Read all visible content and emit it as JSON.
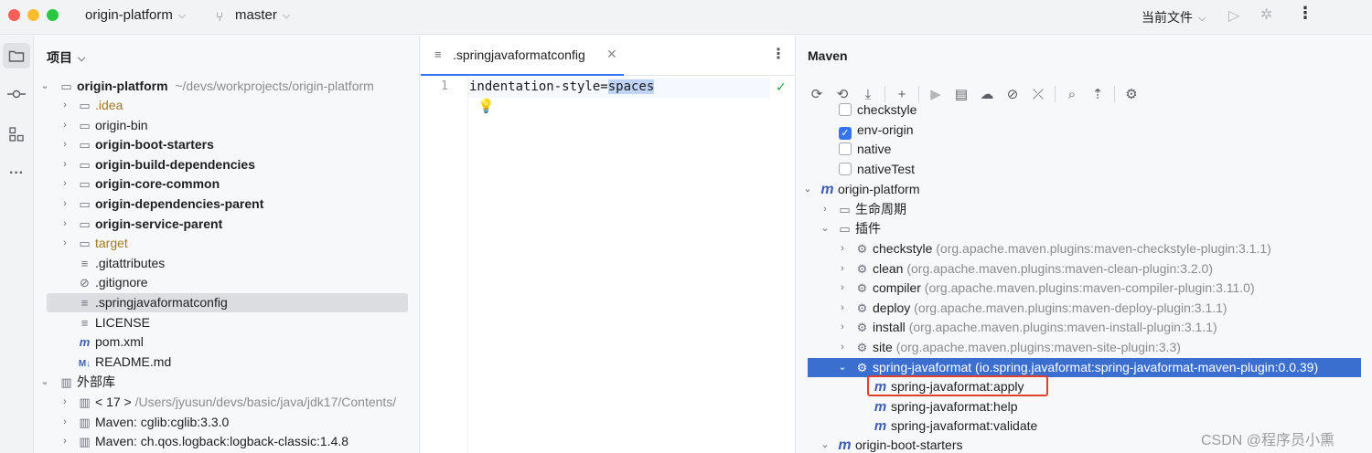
{
  "titlebar": {
    "project_name": "origin-platform",
    "branch": "master",
    "current_file": "当前文件",
    "icons": [
      "chevron-down-icon",
      "branch-icon",
      "run-icon",
      "debug-icon",
      "more-icon"
    ]
  },
  "project_panel": {
    "title": "项目",
    "root": {
      "name": "origin-platform",
      "path": "~/devs/workprojects/origin-platform"
    },
    "items": [
      {
        "label": ".idea",
        "icon": "folder-icon",
        "style": "orange"
      },
      {
        "label": "origin-bin",
        "icon": "folder-icon",
        "style": "normal"
      },
      {
        "label": "origin-boot-starters",
        "icon": "module-folder-icon",
        "style": "bold"
      },
      {
        "label": "origin-build-dependencies",
        "icon": "module-folder-icon",
        "style": "bold"
      },
      {
        "label": "origin-core-common",
        "icon": "module-folder-icon",
        "style": "bold"
      },
      {
        "label": "origin-dependencies-parent",
        "icon": "module-folder-icon",
        "style": "bold"
      },
      {
        "label": "origin-service-parent",
        "icon": "module-folder-icon",
        "style": "bold"
      },
      {
        "label": "target",
        "icon": "folder-icon",
        "style": "orange"
      },
      {
        "label": ".gitattributes",
        "icon": "text-file-icon",
        "style": "normal"
      },
      {
        "label": ".gitignore",
        "icon": "ignore-file-icon",
        "style": "normal"
      },
      {
        "label": ".springjavaformatconfig",
        "icon": "text-file-icon",
        "style": "normal"
      },
      {
        "label": "LICENSE",
        "icon": "text-file-icon",
        "style": "normal"
      },
      {
        "label": "pom.xml",
        "icon": "maven-icon",
        "style": "normal"
      },
      {
        "label": "README.md",
        "icon": "markdown-icon",
        "style": "normal"
      }
    ],
    "external_libs": "外部库",
    "libs": [
      {
        "label": "< 17 >",
        "path": "/Users/jyusun/devs/basic/java/jdk17/Contents/"
      },
      {
        "label": "Maven: cglib:cglib:3.3.0",
        "path": ""
      },
      {
        "label": "Maven: ch.qos.logback:logback-classic:1.4.8",
        "path": ""
      }
    ]
  },
  "editor": {
    "tab_label": ".springjavaformatconfig",
    "line_number": "1",
    "code_key": "indentation-style=",
    "code_value": "spaces"
  },
  "maven_panel": {
    "title": "Maven",
    "profiles": [
      {
        "label": "checkstyle",
        "checked": false
      },
      {
        "label": "env-origin",
        "checked": true
      },
      {
        "label": "native",
        "checked": false
      },
      {
        "label": "nativeTest",
        "checked": false
      }
    ],
    "project": "origin-platform",
    "lifecycle": "生命周期",
    "plugins_label": "插件",
    "plugins": [
      {
        "name": "checkstyle",
        "artifact": "(org.apache.maven.plugins:maven-checkstyle-plugin:3.1.1)"
      },
      {
        "name": "clean",
        "artifact": "(org.apache.maven.plugins:maven-clean-plugin:3.2.0)"
      },
      {
        "name": "compiler",
        "artifact": "(org.apache.maven.plugins:maven-compiler-plugin:3.11.0)"
      },
      {
        "name": "deploy",
        "artifact": "(org.apache.maven.plugins:maven-deploy-plugin:3.1.1)"
      },
      {
        "name": "install",
        "artifact": "(org.apache.maven.plugins:maven-install-plugin:3.1.1)"
      },
      {
        "name": "site",
        "artifact": "(org.apache.maven.plugins:maven-site-plugin:3.3)"
      },
      {
        "name": "spring-javaformat",
        "artifact": "(io.spring.javaformat:spring-javaformat-maven-plugin:0.0.39)"
      }
    ],
    "goals": [
      "spring-javaformat:apply",
      "spring-javaformat:help",
      "spring-javaformat:validate"
    ],
    "next_project": "origin-boot-starters"
  },
  "watermark": "CSDN @程序员小熏"
}
